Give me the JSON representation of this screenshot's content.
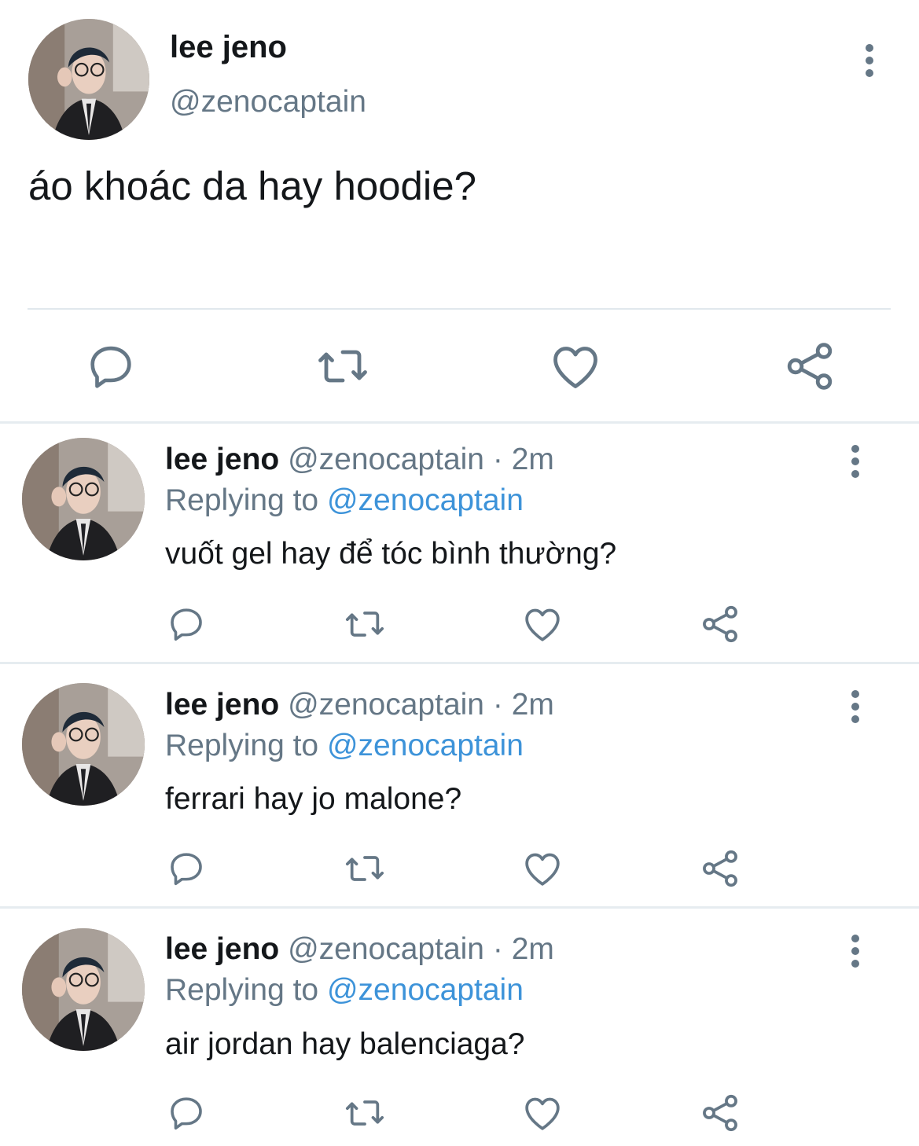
{
  "main_tweet": {
    "display_name": "lee jeno",
    "handle": "@zenocaptain",
    "text": "áo khoác da hay hoodie?",
    "avatar_icon": "profile-photo",
    "menu_icon": "more-vertical-icon",
    "actions": [
      "reply-icon",
      "retweet-icon",
      "like-icon",
      "share-icon"
    ]
  },
  "replies": [
    {
      "display_name": "lee jeno",
      "handle": "@zenocaptain",
      "separator": "·",
      "time": "2m",
      "replying_label": "Replying to",
      "replying_handle": "@zenocaptain",
      "text": "vuốt gel hay để tóc bình thường?"
    },
    {
      "display_name": "lee jeno",
      "handle": "@zenocaptain",
      "separator": "·",
      "time": "2m",
      "replying_label": "Replying to",
      "replying_handle": "@zenocaptain",
      "text": "ferrari hay jo malone?"
    },
    {
      "display_name": "lee jeno",
      "handle": "@zenocaptain",
      "separator": "·",
      "time": "2m",
      "replying_label": "Replying to",
      "replying_handle": "@zenocaptain",
      "text": "air jordan hay balenciaga?"
    }
  ],
  "colors": {
    "text_primary": "#14171a",
    "text_secondary": "#657786",
    "link": "#3d93d9",
    "divider": "#e1e8ed"
  }
}
